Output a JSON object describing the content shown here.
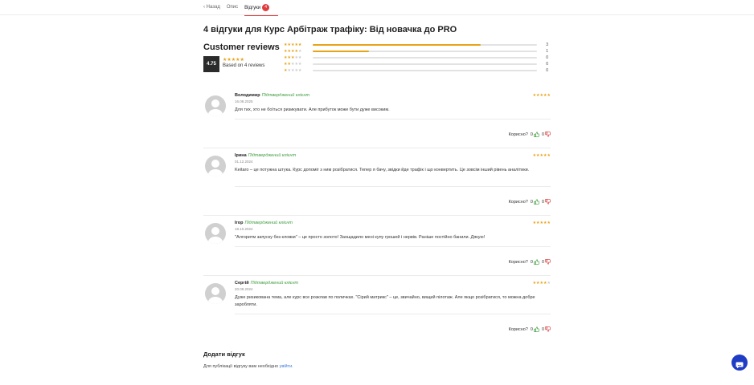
{
  "tabs": [
    {
      "label": "‹ Назад"
    },
    {
      "label": "Опис"
    },
    {
      "label": "Відгуки",
      "badge": "4"
    }
  ],
  "page_title": "4 відгуки для Курс Арбітраж трафіку: Від новачка до PRO",
  "summary": {
    "title": "Customer reviews",
    "average": "4.75",
    "based_on": "Based on 4 reviews",
    "average_value": 4.75,
    "breakdown": [
      {
        "stars": 5,
        "count": "3",
        "fraction": 0.75
      },
      {
        "stars": 4,
        "count": "1",
        "fraction": 0.25
      },
      {
        "stars": 3,
        "count": "0",
        "fraction": 0
      },
      {
        "stars": 2,
        "count": "0",
        "fraction": 0
      },
      {
        "stars": 1,
        "count": "0",
        "fraction": 0
      }
    ]
  },
  "reviews": [
    {
      "author": "Володимир",
      "verified": "Підтверджений клієнт",
      "date": "16.08.2025",
      "rating": 5,
      "text": "Для тих, хто не боїться ризикувати. Але прибуток може бути дуже високим.",
      "helpful_label": "Корисно?",
      "likes": "0",
      "dislikes": "0"
    },
    {
      "author": "Ірина",
      "verified": "Підтверджений клієнт",
      "date": "01.12.2024",
      "rating": 5,
      "text": "Keitaro – це потужна штука. Курс допоміг з ним розібратися. Тепер я бачу, звідки йде трафік і що конвертить. Це зовсім інший рівень аналітики.",
      "helpful_label": "Корисно?",
      "likes": "0",
      "dislikes": "0"
    },
    {
      "author": "Ігор",
      "verified": "Підтверджений клієнт",
      "date": "18.10.2024",
      "rating": 5,
      "text": "\"Алгоритм запуску без кловки\" – це просто золото! Заощадило мені купу грошей і нервів. Раніше постійно банили. Дякую!",
      "helpful_label": "Корисно?",
      "likes": "0",
      "dislikes": "0"
    },
    {
      "author": "Сергій",
      "verified": "Підтверджений клієнт",
      "date": "20.09.2024",
      "rating": 4,
      "text": "Дуже ризикована тема, але курс все розклав по поличках. \"Сірий матрикс\" – це, звичайно, вищий пілотаж. Але якщо розібратися, то можна добре заробляти.",
      "helpful_label": "Корисно?",
      "likes": "0",
      "dislikes": "0"
    }
  ],
  "add_review": {
    "title": "Додати відгук",
    "note": "Для публікації відгуку вам необхідно ",
    "link": "увійти."
  },
  "colors": {
    "star": "#e8a317",
    "verified": "#3c9d3c",
    "accent": "#e03c3c",
    "chat": "#1f3cc4",
    "link": "#3a78d8"
  },
  "icons": {
    "like": "thumbs-up-icon",
    "dislike": "thumbs-down-icon",
    "chat": "chat-bubble-icon",
    "avatar": "default-avatar"
  }
}
